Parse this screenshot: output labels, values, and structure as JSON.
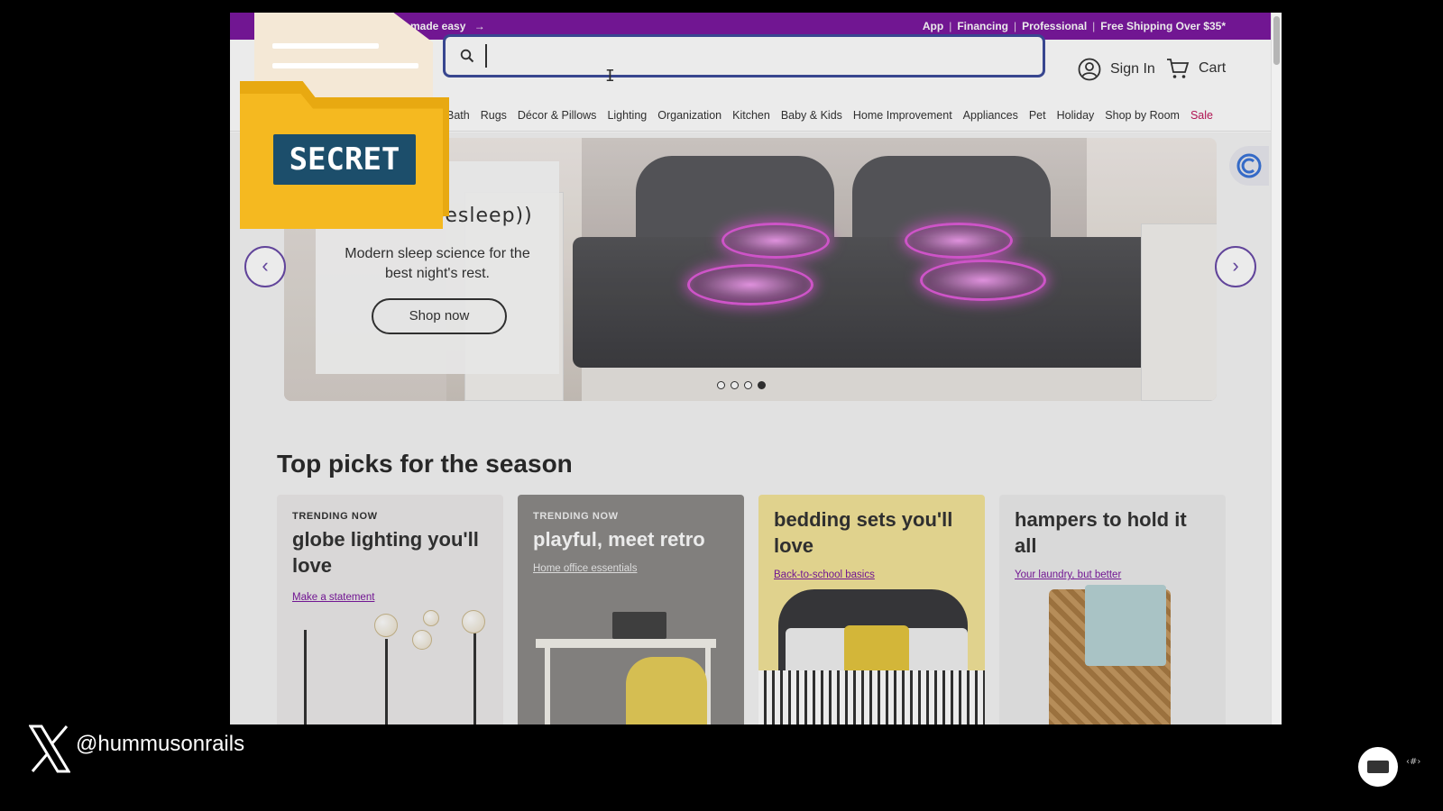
{
  "topbar": {
    "promo": "made easy",
    "links": [
      "App",
      "Financing",
      "Professional",
      "Free Shipping Over $35*"
    ],
    "separator": "|"
  },
  "header": {
    "search_value": "",
    "sign_in": "Sign In",
    "cart": "Cart"
  },
  "catnav": {
    "items": [
      "Bath",
      "Rugs",
      "Décor & Pillows",
      "Lighting",
      "Organization",
      "Kitchen",
      "Baby & Kids",
      "Home Improvement",
      "Appliances",
      "Pet",
      "Holiday",
      "Shop by Room",
      "Sale"
    ]
  },
  "hero": {
    "brand": "((goodvibesleep))",
    "tagline": "Modern sleep science for the best night's rest.",
    "cta": "Shop now",
    "slides_total": 4,
    "active_slide": 4
  },
  "section": {
    "title": "Top picks for the season"
  },
  "cards": [
    {
      "kicker": "TRENDING NOW",
      "title": "globe lighting you'll love",
      "link": "Make a statement"
    },
    {
      "kicker": "TRENDING NOW",
      "title": "playful, meet retro",
      "link": "Home office essentials"
    },
    {
      "kicker": "",
      "title": "bedding sets you'll love",
      "link": "Back-to-school basics"
    },
    {
      "kicker": "",
      "title": "hampers to hold it all",
      "link": "Your laundry, but better"
    }
  ],
  "overlay": {
    "secret_label": "SECRET"
  },
  "footer": {
    "handle": "@hummusonrails",
    "slide_number": "‹#›"
  },
  "colors": {
    "brand_purple": "#7b189f",
    "sale": "#c0185b",
    "search_border": "#3d4c9c",
    "folder_yellow": "#f5b920",
    "secret_label_bg": "#1c4e6b"
  },
  "icons": [
    "search-icon",
    "user-icon",
    "cart-icon",
    "arrow-right-icon",
    "chevron-left-icon",
    "chevron-right-icon",
    "x-logo-icon"
  ]
}
